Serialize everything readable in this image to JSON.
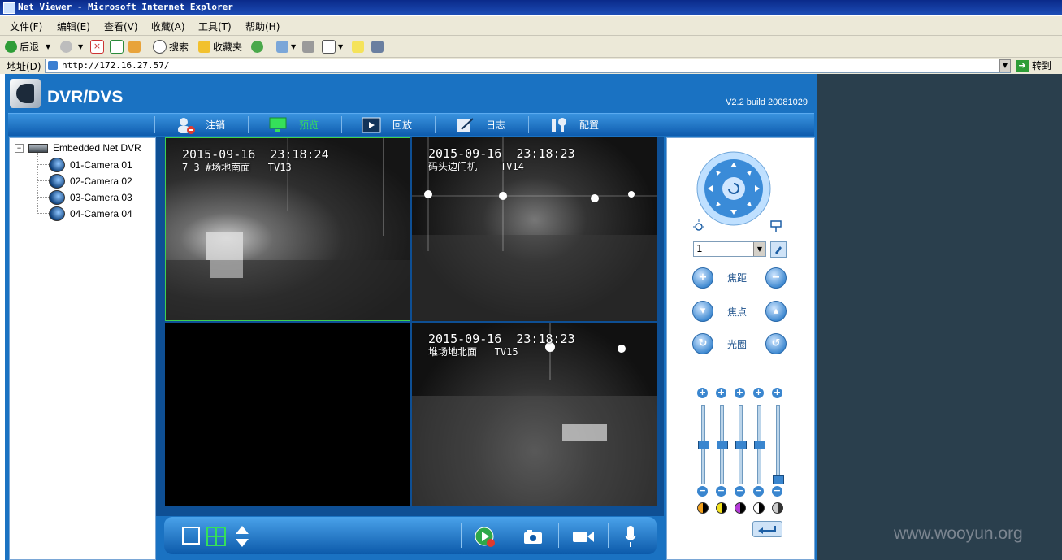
{
  "window": {
    "title": "Net Viewer - Microsoft Internet Explorer"
  },
  "menu": [
    "文件(F)",
    "编辑(E)",
    "查看(V)",
    "收藏(A)",
    "工具(T)",
    "帮助(H)"
  ],
  "toolbar": {
    "back": "后退",
    "search": "搜索",
    "favorites": "收藏夹"
  },
  "address": {
    "label": "地址(D)",
    "url": "http://172.16.27.57/",
    "go": "转到"
  },
  "app": {
    "brand": "DVR/DVS",
    "version": "V2.2  build 20081029"
  },
  "nav": [
    {
      "label": "注销",
      "active": false
    },
    {
      "label": "预览",
      "active": true
    },
    {
      "label": "回放",
      "active": false
    },
    {
      "label": "日志",
      "active": false
    },
    {
      "label": "配置",
      "active": false
    }
  ],
  "tree": {
    "root": "Embedded Net DVR",
    "cameras": [
      "01-Camera 01",
      "02-Camera 02",
      "03-Camera 03",
      "04-Camera 04"
    ]
  },
  "tiles": [
    {
      "timestamp": "2015-09-16  23:18:24",
      "caption": "7 3 #场地南面   TV13"
    },
    {
      "timestamp": "2015-09-16  23:18:23",
      "caption": "码头边门机    TV14"
    },
    {
      "timestamp": "",
      "caption": ""
    },
    {
      "timestamp": "2015-09-16  23:18:23",
      "caption": "堆场地北面   TV15"
    }
  ],
  "ptz": {
    "preset_value": "1",
    "zoom_label": "焦距",
    "focus_label": "焦点",
    "iris_label": "光圈"
  },
  "sliders": [
    {
      "name": "brightness",
      "level": 0.5
    },
    {
      "name": "contrast",
      "level": 0.5
    },
    {
      "name": "saturation",
      "level": 0.5
    },
    {
      "name": "hue",
      "level": 0.5
    },
    {
      "name": "volume",
      "level": 0.0
    }
  ],
  "watermark": "www.wooyun.org",
  "colors": {
    "accent": "#1a72c2",
    "active_nav": "#35e05a",
    "titlebar": "#0a2a8a"
  }
}
